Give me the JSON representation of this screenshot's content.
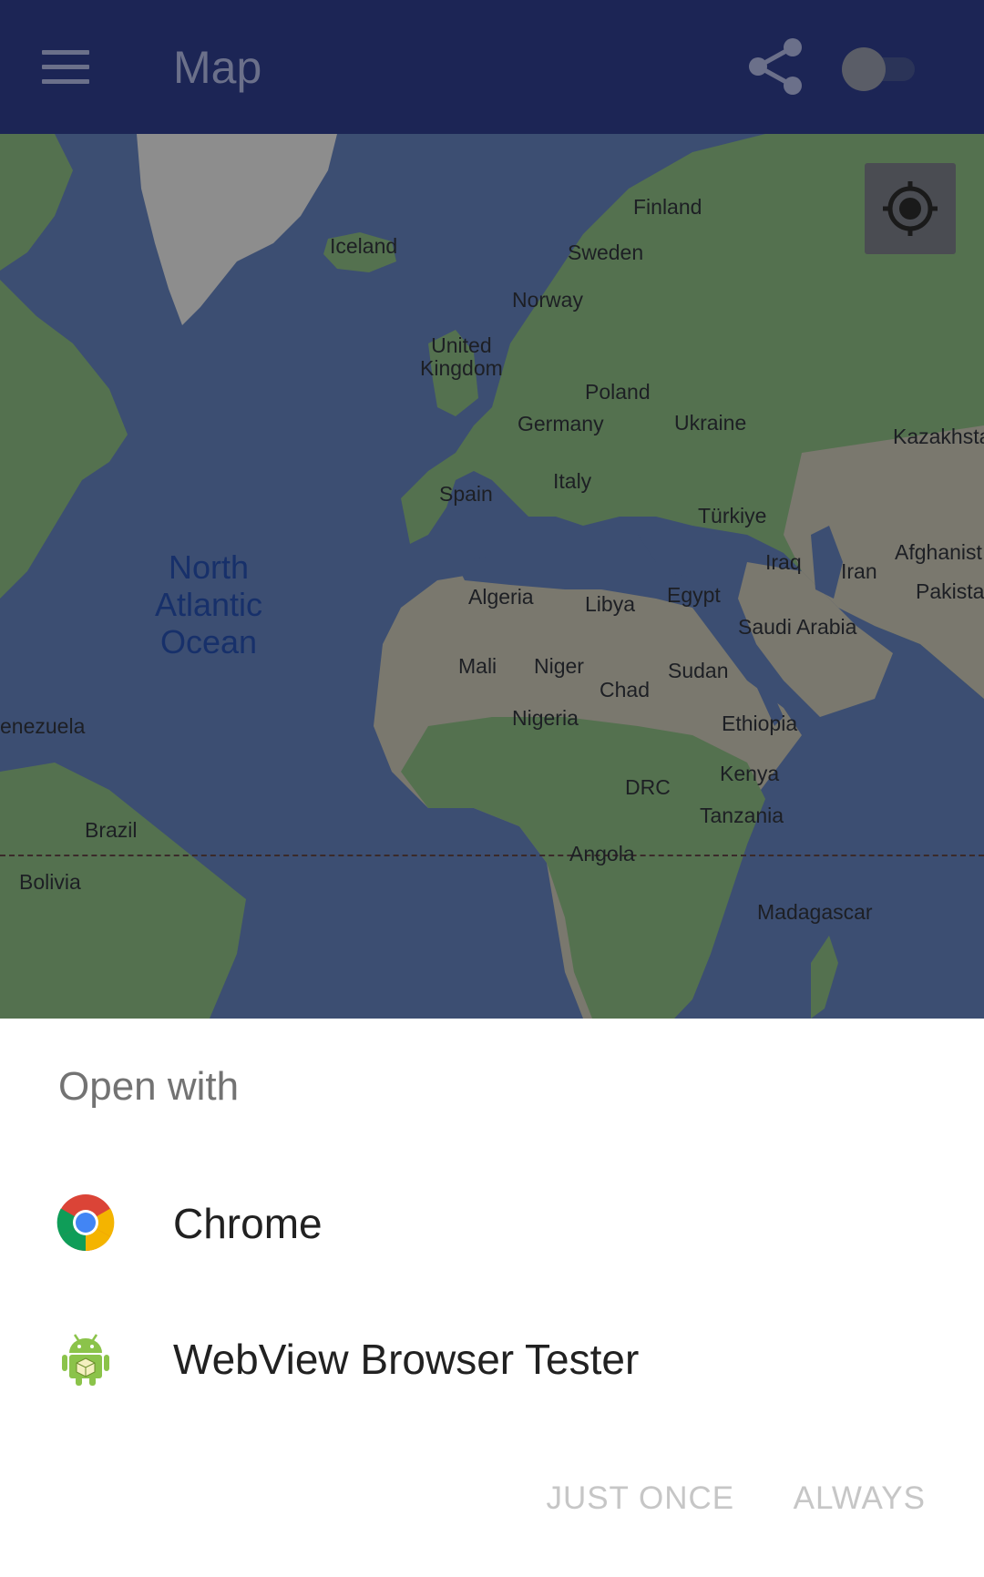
{
  "appbar": {
    "title": "Map",
    "menu_icon": "menu-icon",
    "share_icon": "share-icon",
    "toggle_state": "off"
  },
  "map": {
    "ocean_label": "North\nAtlantic\nOcean",
    "countries": [
      "Finland",
      "Iceland",
      "Sweden",
      "Norway",
      "United\nKingdom",
      "Poland",
      "Germany",
      "Ukraine",
      "Kazakhsta",
      "Spain",
      "Italy",
      "Türkiye",
      "Iraq",
      "Iran",
      "Afghanist",
      "Pakista",
      "Algeria",
      "Libya",
      "Egypt",
      "Saudi Arabia",
      "Mali",
      "Niger",
      "Chad",
      "Sudan",
      "Nigeria",
      "Ethiopia",
      "enezuela",
      "Kenya",
      "DRC",
      "Tanzania",
      "Brazil",
      "Angola",
      "Bolivia",
      "Madagascar"
    ],
    "locate_icon": "my-location-icon"
  },
  "sheet": {
    "title": "Open with",
    "apps": [
      {
        "label": "Chrome",
        "icon": "chrome-icon"
      },
      {
        "label": "WebView Browser Tester",
        "icon": "android-icon"
      }
    ],
    "just_once": "JUST ONCE",
    "always": "ALWAYS"
  },
  "colors": {
    "appbar": "#1c2555",
    "ocean": "#3c4e72",
    "land": "#54714f",
    "desert": "#7a786e",
    "ice": "#8d8d8d",
    "sheet_bg": "#ffffff"
  }
}
